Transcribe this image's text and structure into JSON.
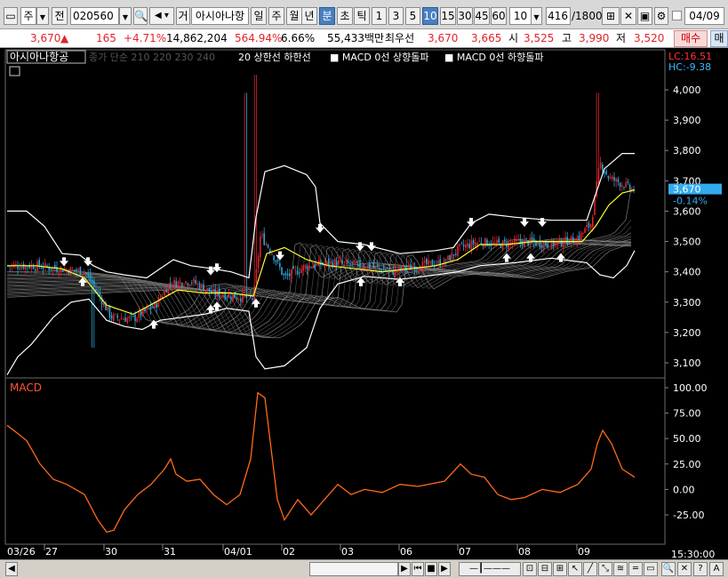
{
  "toolbar": {
    "market": "주",
    "mode": "전",
    "code": "020560",
    "name_btn": "거",
    "name": "아시아나항",
    "periods": [
      "일",
      "주",
      "월",
      "년"
    ],
    "period_active": "분",
    "period_extra": [
      "초",
      "틱"
    ],
    "intervals": [
      "1",
      "3",
      "5",
      "10",
      "15",
      "30",
      "45",
      "60"
    ],
    "interval_active": "10",
    "interval_select": "10",
    "count": "416",
    "count_total": "/1800",
    "date": "04/09"
  },
  "quote": {
    "price": "3,670",
    "change": "165",
    "change_pct": "+4.71%",
    "volume": "14,862,204",
    "vol_ratio": "564.94%",
    "turnover": "6.66%",
    "amount": "55,433백만",
    "priority_label": "최우선",
    "ask": "3,670",
    "bid": "3,665",
    "open_label": "시",
    "open": "3,525",
    "high_label": "고",
    "high": "3,990",
    "low_label": "저",
    "low": "3,520",
    "buy_btn": "매수",
    "sell_btn": "매"
  },
  "legend": {
    "stock": "아시아나항공",
    "ma": "종가 단순 210  220  230  240",
    "bb": "20  상한선  하한선",
    "sig1": "■ MACD 0선 상향돌파",
    "sig2": "■ MACD 0선 하향돌파",
    "lc": "LC:16.51",
    "hc": "HC:-9.38"
  },
  "price_axis": {
    "ticks": [
      "4,000",
      "3,900",
      "3,800",
      "3,700",
      "3,600",
      "3,500",
      "3,400",
      "3,300",
      "3,200",
      "3,100"
    ],
    "current": "3,670",
    "current_pct": "-0.14%"
  },
  "macd_axis": {
    "label": "MACD",
    "ticks": [
      "100.00",
      "75.00",
      "50.00",
      "25.00",
      "0.00",
      "-25.00"
    ]
  },
  "x_axis": {
    "labels": [
      "03/26",
      "27",
      "30",
      "31",
      "04/01",
      "02",
      "03",
      "06",
      "07",
      "08",
      "09"
    ],
    "time": "15:30:00"
  },
  "colors": {
    "up": "#e0242c",
    "down": "#2aa5d8",
    "bb": "#ffffff",
    "ma": "#ffff33",
    "macd": "#ff6a1a",
    "grid": "#303030"
  },
  "chart_data": [
    {
      "type": "line",
      "title": "아시아나항공",
      "description": "10-minute candles with Bollinger band (20) and moving average; approximate close path",
      "x": [
        "03/26",
        "27",
        "30",
        "31",
        "04/01",
        "02",
        "03",
        "06",
        "07",
        "08",
        "09"
      ],
      "series": [
        {
          "name": "종가",
          "values": [
            3420,
            3400,
            3250,
            3330,
            3310,
            3400,
            3430,
            3400,
            3470,
            3500,
            3670
          ]
        }
      ],
      "ylim": [
        3050,
        4050
      ]
    },
    {
      "type": "line",
      "title": "MACD",
      "x": [
        "03/26",
        "27",
        "30",
        "31",
        "04/01",
        "02",
        "03",
        "06",
        "07",
        "08",
        "09"
      ],
      "series": [
        {
          "name": "MACD",
          "values": [
            63,
            0,
            -15,
            8,
            -5,
            -5,
            10,
            5,
            3,
            -5,
            55
          ]
        }
      ],
      "ylim": [
        -45,
        105
      ]
    }
  ]
}
